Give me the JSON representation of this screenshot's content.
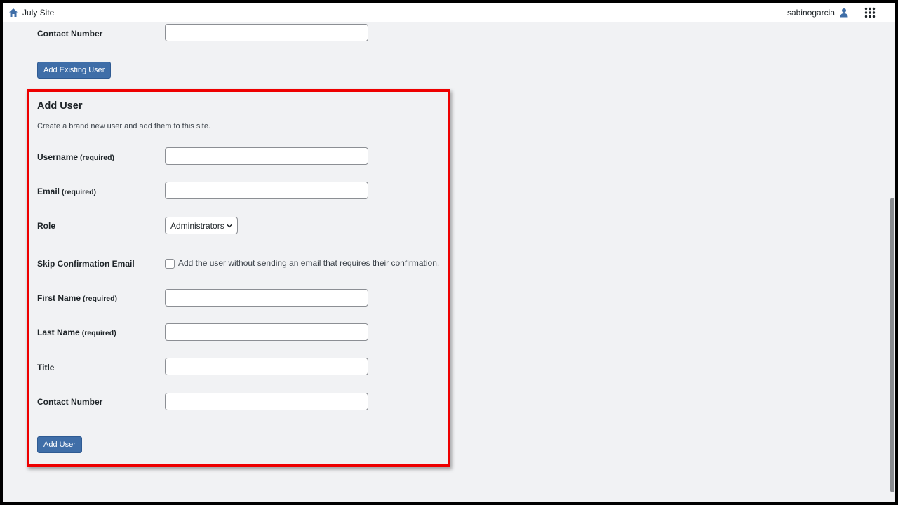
{
  "topbar": {
    "site_name": "July Site",
    "username": "sabinogarcia",
    "icons": [
      "home-icon",
      "user-icon",
      "apps-grid-icon"
    ]
  },
  "existing_user": {
    "contact_number_label": "Contact Number",
    "add_existing_button": "Add Existing User"
  },
  "add_user": {
    "title": "Add User",
    "description": "Create a brand new user and add them to this site.",
    "required_tag": "(required)",
    "username_label": "Username",
    "email_label": "Email",
    "role_label": "Role",
    "role_value": "Administrators",
    "skip_label": "Skip Confirmation Email",
    "skip_text": "Add the user without sending an email that requires their confirmation.",
    "first_name_label": "First Name",
    "last_name_label": "Last Name",
    "title_label": "Title",
    "contact_number_label": "Contact Number",
    "add_user_button": "Add User"
  },
  "colors": {
    "primary_button": "#3f6ea8",
    "highlight_border": "#ee0000",
    "background": "#f1f2f4"
  }
}
